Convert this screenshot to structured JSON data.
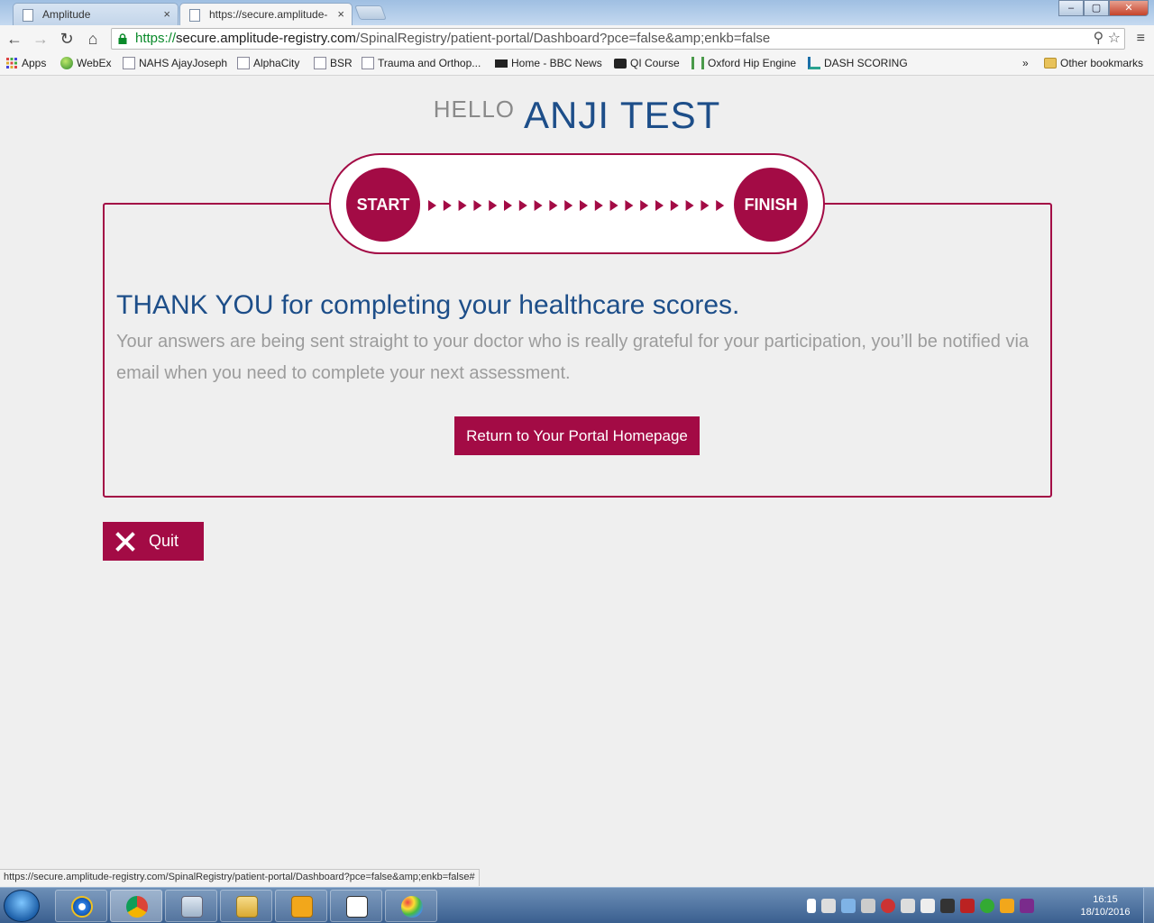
{
  "browser": {
    "tabs": [
      {
        "label": "Amplitude",
        "active": false
      },
      {
        "label": "https://secure.amplitude-",
        "active": true
      }
    ],
    "tab_close": "×",
    "window_buttons": {
      "minimize": "–",
      "maximize": "▢",
      "close": "✕"
    },
    "address": {
      "scheme": "https://",
      "host": "secure.amplitude-registry.com",
      "path": "/SpinalRegistry/patient-portal/Dashboard?pce=false&amp;enkb=false"
    },
    "nav": {
      "back": "←",
      "forward": "→",
      "reload": "↻",
      "home": "⌂",
      "search": "⚲",
      "star": "☆",
      "menu": "≡"
    },
    "bookmarks": [
      {
        "label": "Apps"
      },
      {
        "label": "WebEx"
      },
      {
        "label": "NAHS AjayJoseph"
      },
      {
        "label": "AlphaCity"
      },
      {
        "label": "BSR"
      },
      {
        "label": "Trauma and Orthop..."
      },
      {
        "label": "Home - BBC News"
      },
      {
        "label": "QI Course"
      },
      {
        "label": "Oxford Hip Engine"
      },
      {
        "label": "DASH SCORING"
      }
    ],
    "bookmarks_more": "»",
    "other_bookmarks": "Other bookmarks",
    "status_url": "https://secure.amplitude-registry.com/SpinalRegistry/patient-portal/Dashboard?pce=false&amp;enkb=false#"
  },
  "page": {
    "greeting": "HELLO",
    "user_name": "ANJI TEST",
    "progress": {
      "start_label": "START",
      "finish_label": "FINISH",
      "arrow_count": 20,
      "fraction_complete": 1.0
    },
    "thanks_heading": "THANK YOU for completing your healthcare scores.",
    "description": "Your answers are being sent straight to your doctor who is really grateful for your participation, you’ll be notified via email when you need to complete your next assessment.",
    "return_button": "Return to Your Portal Homepage",
    "quit_button": "Quit"
  },
  "colors": {
    "brand": "#a30b45",
    "heading_blue": "#1d4e89",
    "muted_text": "#9c9c9c",
    "background": "#efefef"
  },
  "taskbar": {
    "apps": [
      "internet-explorer",
      "chrome",
      "calculator",
      "file-explorer",
      "outlook",
      "sirs",
      "paint"
    ],
    "clock_time": "16:15",
    "clock_date": "18/10/2016"
  }
}
